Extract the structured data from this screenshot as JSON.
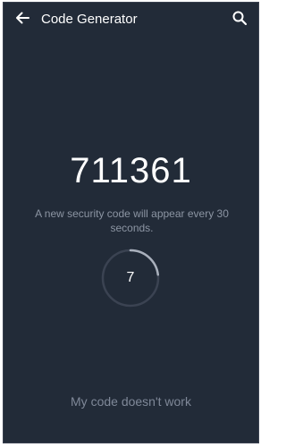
{
  "appbar": {
    "title": "Code Generator",
    "back_icon": "arrow-left-icon",
    "search_icon": "search-icon"
  },
  "code": {
    "value": "711361",
    "hint": "A new security code will appear every 30 seconds."
  },
  "timer": {
    "seconds_remaining": "7",
    "period_seconds": 30,
    "progress_fraction": 0.23
  },
  "footer": {
    "help_link": "My code doesn't work"
  },
  "colors": {
    "background": "#222b38",
    "ring_track": "#3b4352",
    "ring_progress": "#a9b0bc",
    "hint_text": "#8c95a3"
  }
}
